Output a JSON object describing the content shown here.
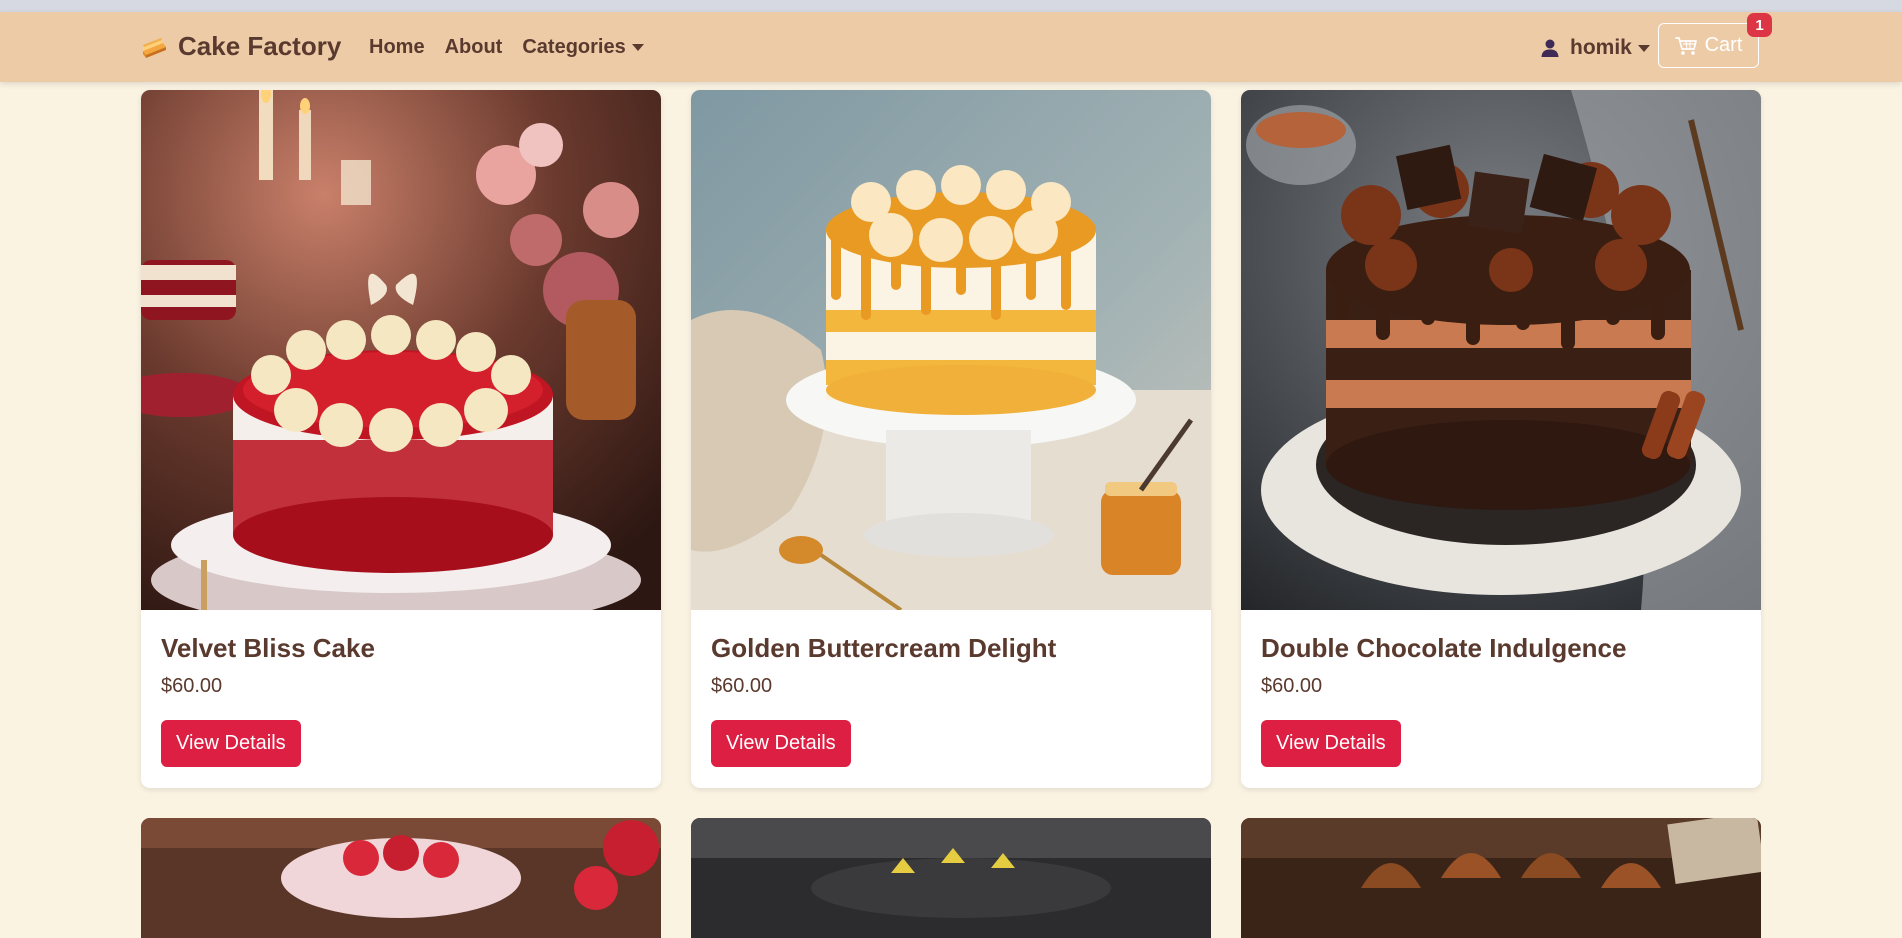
{
  "navbar": {
    "brand": "Cake Factory",
    "links": [
      {
        "label": "Home"
      },
      {
        "label": "About"
      },
      {
        "label": "Categories"
      }
    ],
    "user": "homik",
    "cart_label": "Cart",
    "cart_count": "1"
  },
  "products": [
    {
      "name": "Velvet Bliss Cake",
      "price": "$60.00",
      "button": "View Details",
      "image": "red-velvet-cake"
    },
    {
      "name": "Golden Buttercream Delight",
      "price": "$60.00",
      "button": "View Details",
      "image": "golden-buttercream-cake"
    },
    {
      "name": "Double Chocolate Indulgence",
      "price": "$60.00",
      "button": "View Details",
      "image": "double-chocolate-cake"
    }
  ],
  "next_row_images": [
    "strawberry-cake",
    "dark-cake",
    "chocolate-kiss-cake"
  ],
  "colors": {
    "navbar": "#eccba6",
    "page_bg": "#fbf3e2",
    "text": "#5a3a2e",
    "button": "#dc1f42",
    "badge": "#dc3545"
  }
}
